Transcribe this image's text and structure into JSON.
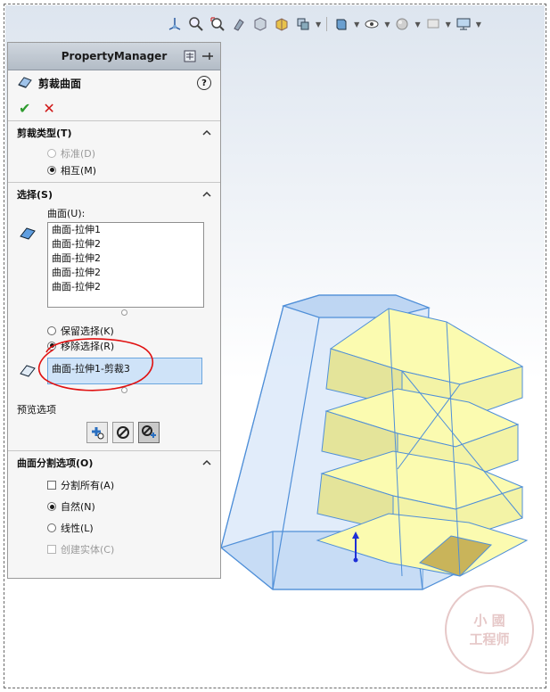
{
  "toolbar": {
    "icons": [
      "view-orientation-icon",
      "zoom-to-fit-icon",
      "zoom-area-icon",
      "pan-icon",
      "section-view-icon",
      "display-style-icon",
      "view-cube-icon",
      "appearance-icon",
      "scene-icon",
      "monitor-icon"
    ]
  },
  "panel": {
    "title": "PropertyManager",
    "feature_name": "剪裁曲面",
    "help": "?",
    "ok_symbol": "✔",
    "cancel_symbol": "✕"
  },
  "trim_type": {
    "header": "剪裁类型(T)",
    "options": [
      {
        "label": "标准(D)",
        "selected": false,
        "enabled": false
      },
      {
        "label": "相互(M)",
        "selected": true,
        "enabled": true
      }
    ]
  },
  "selection": {
    "header": "选择(S)",
    "surfaces_label": "曲面(U):",
    "surfaces": [
      "曲面-拉伸1",
      "曲面-拉伸2",
      "曲面-拉伸2",
      "曲面-拉伸2",
      "曲面-拉伸2"
    ],
    "keep_label": "保留选择(K)",
    "remove_label": "移除选择(R)",
    "remove_value": "曲面-拉伸1-剪裁3"
  },
  "preview": {
    "label": "预览选项"
  },
  "split": {
    "header": "曲面分割选项(O)",
    "split_all": "分割所有(A)",
    "natural": "自然(N)",
    "linear": "线性(L)",
    "create_solid": "创建实体(C)"
  },
  "colors": {
    "accent": "#6aa6de",
    "surface_yellow": "#fbfbb0",
    "surface_blue": "#b9d6f5",
    "annotation_red": "#e01010"
  },
  "watermark": {
    "line1": "小  國",
    "line2": "工程师"
  }
}
